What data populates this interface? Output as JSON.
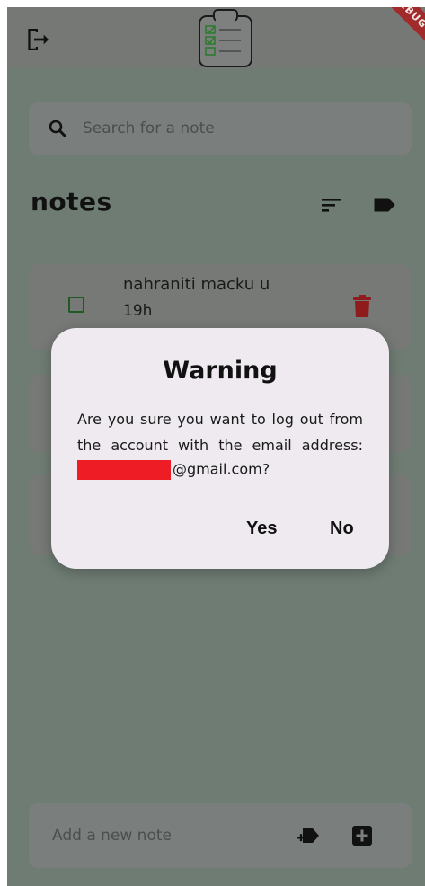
{
  "header": {
    "logout_icon": "logout-icon",
    "logo_icon": "clipboard-checklist-icon",
    "debug_banner": "DEBUG"
  },
  "search": {
    "placeholder": "Search for a note",
    "icon": "search-icon"
  },
  "notes_section": {
    "title": "notes",
    "sort_icon": "sort-icon",
    "label_icon": "label-icon"
  },
  "notes": [
    {
      "title": "nahraniti macku u",
      "time": "19h",
      "checked": false
    }
  ],
  "dialog": {
    "title": "Warning",
    "message_line1": "Are you sure you want to log out from",
    "message_line2": "the account with the email address:",
    "email_suffix": "@gmail.com?",
    "yes_label": "Yes",
    "no_label": "No"
  },
  "add_note": {
    "placeholder": "Add a new note",
    "tag_icon": "add-tag-icon",
    "add_icon": "add-box-icon"
  },
  "colors": {
    "checkbox": "#1f5a23",
    "trash": "#8f1c1c",
    "redaction": "#ee1c25",
    "dialog_bg": "#eeeaf0"
  }
}
